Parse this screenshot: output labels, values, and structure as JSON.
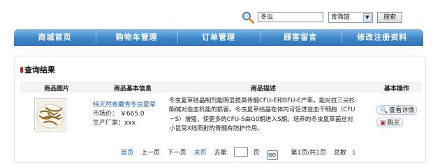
{
  "search": {
    "query": "冬虫",
    "store": "青海馆",
    "button": "搜索"
  },
  "nav": [
    "商城首页",
    "购物车管理",
    "订单管理",
    "顾客留言",
    "修改注册资料"
  ],
  "panel": {
    "title": "查询结果"
  },
  "table": {
    "headers": [
      "商品图片",
      "商品基本信息",
      "商品描述",
      "基本操作"
    ],
    "rows": [
      {
        "name": "纯天然青藏青冬虫夏草",
        "price": "市场价：  ￥665.0",
        "maker": "生产厂家：xxx",
        "description": "冬虫夏草结晶制剂能明显提高骨髓CFU-E和BFU-E产率，能对抗三尖杉酯碱对造血机能的损害。冬虫夏草结晶在体内可促进造血干细胞（CFU－S）增殖，使更多的CFU-S由G0期进入S期。培养的冬虫夏草菌丝对小鼠受X线照射的骨髓有防护作用。",
        "detail_button": "查看详情",
        "buy_button": "购买"
      }
    ]
  },
  "pager": {
    "first": "首页",
    "prev": "上一页",
    "next": "下一页",
    "last": "末页",
    "goto_prefix": "去第",
    "goto_suffix": "页",
    "go": "GO",
    "status": "第1页/共1页",
    "total_label": "总数",
    "total_value": "1"
  },
  "colors": {
    "nav_top": "#7fb8e6",
    "nav_bottom": "#2f74b6",
    "link": "#1a5ea8",
    "accent": "#c8261e"
  }
}
